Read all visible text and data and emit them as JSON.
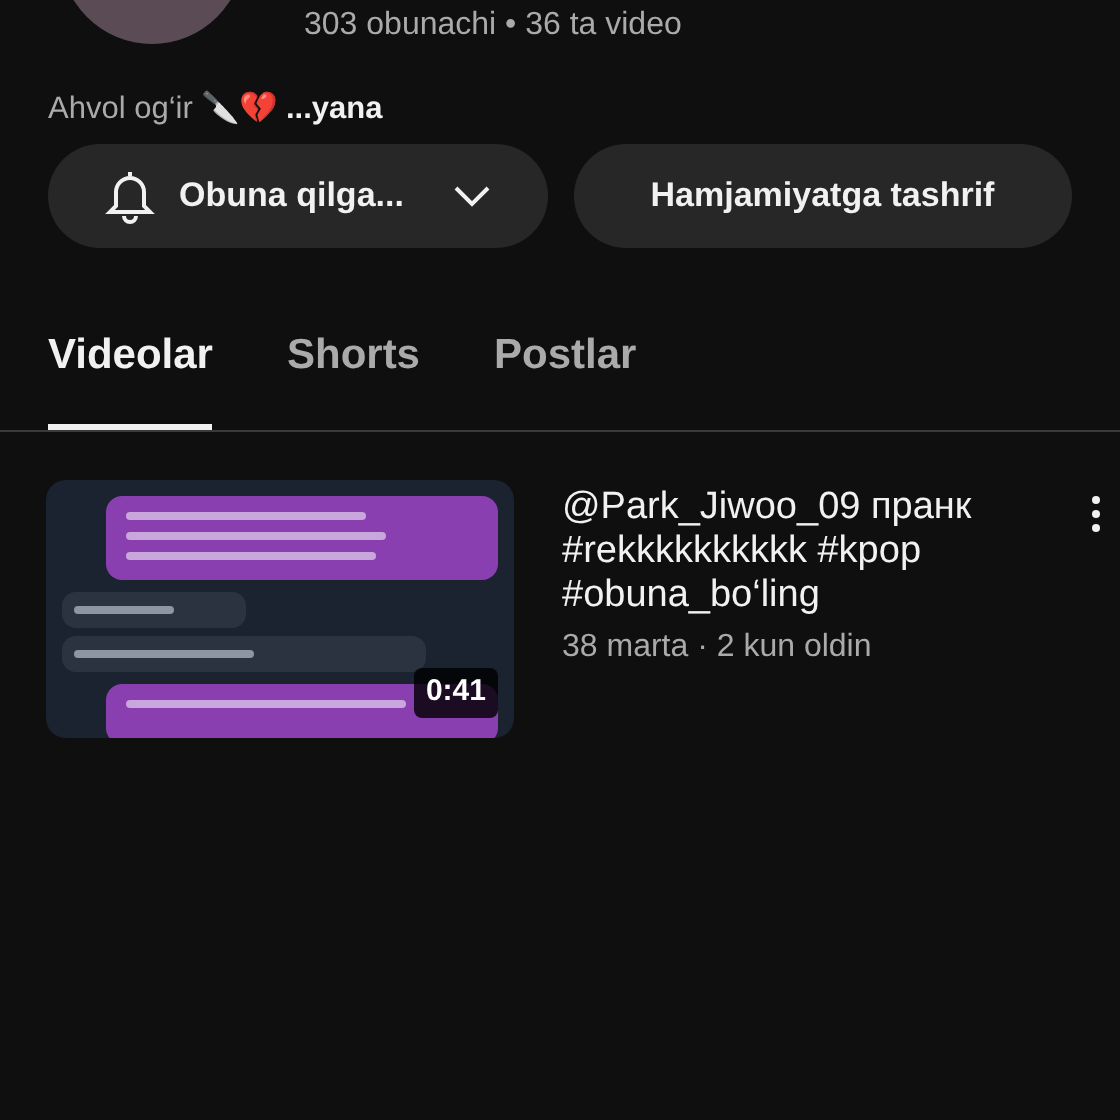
{
  "channel": {
    "stats": "303 obunachi • 36 ta video",
    "bio": "Ahvol og‘ir 🔪💔 **...yana**"
  },
  "buttons": [
    {
      "kind": "subscribed",
      "label": "Obuna qilga..."
    },
    {
      "kind": "plain",
      "label": "Hamjamiyatga tashrif"
    }
  ],
  "tabs": [
    {
      "label": "Videolar",
      "selected": true
    },
    {
      "label": "Shorts",
      "selected": false
    },
    {
      "label": "Postlar",
      "selected": false
    }
  ],
  "videos": [
    {
      "duration": "0:41",
      "title": "@Park_Jiwoo_09 пранк #rekkkkkkkkkk #kpop #obuna_bo‘ling",
      "meta": "38 marta · 2 kun oldin"
    }
  ]
}
